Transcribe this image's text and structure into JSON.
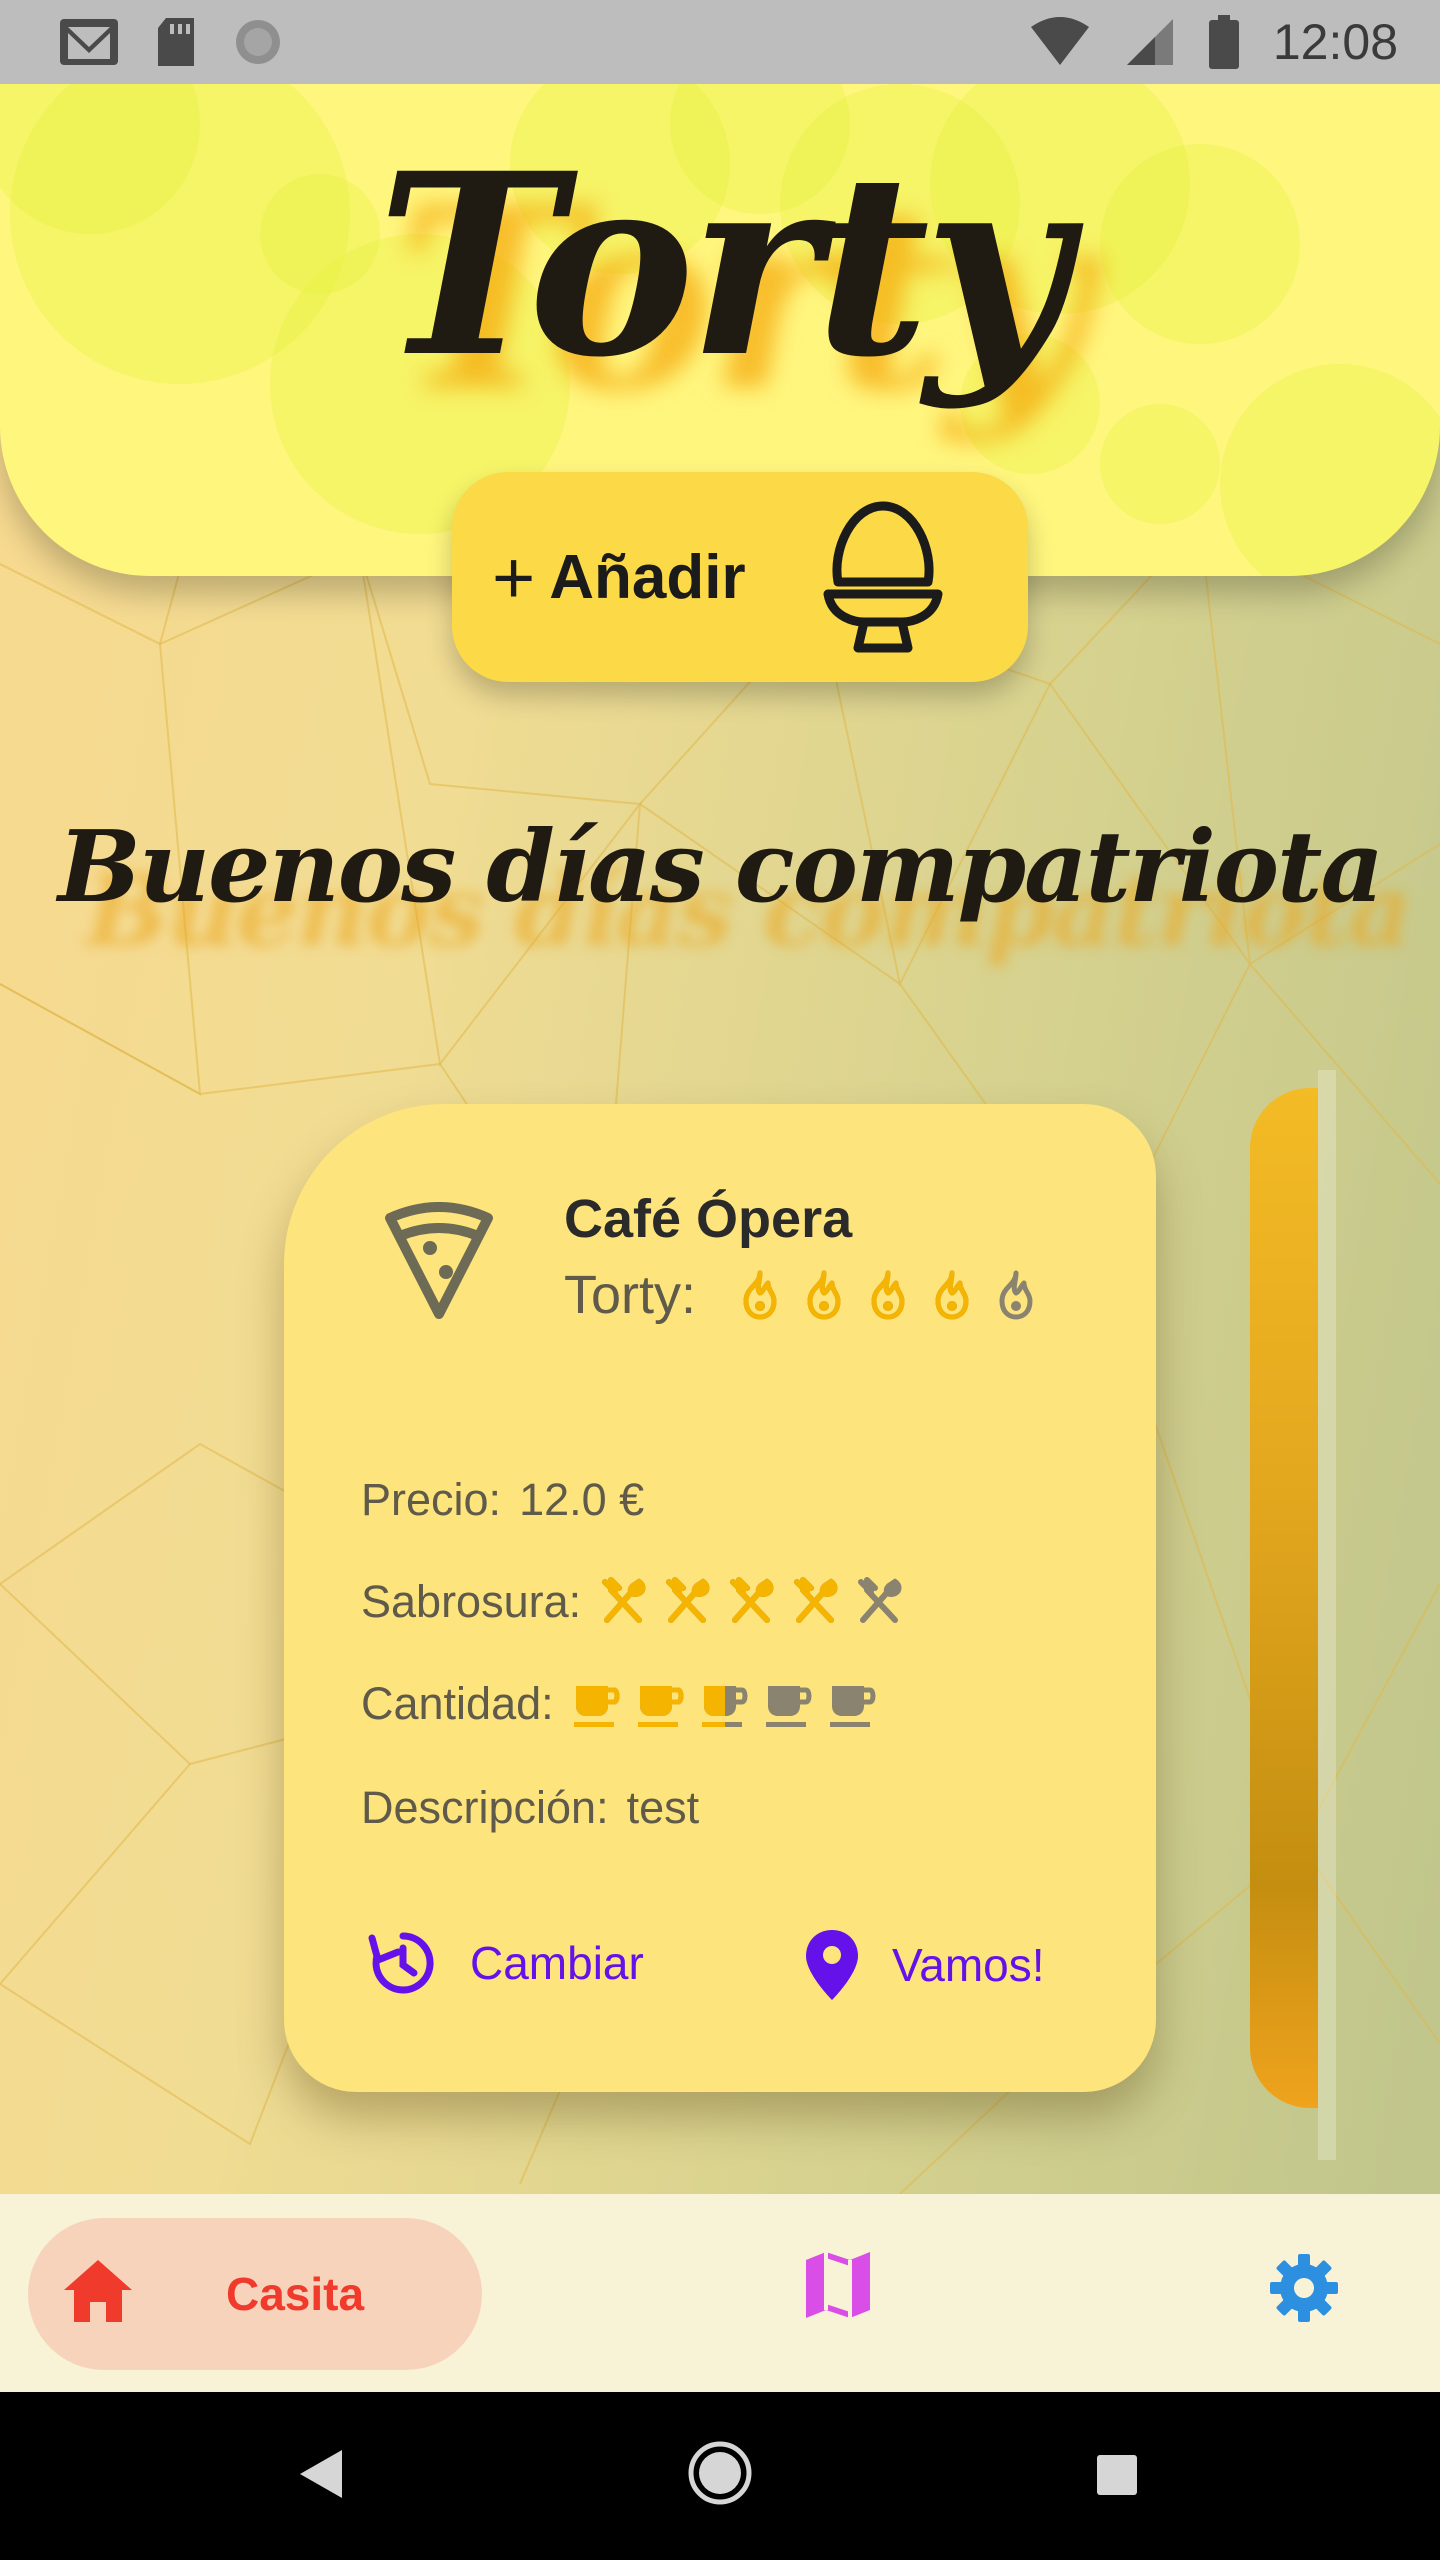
{
  "status_bar": {
    "time": "12:08",
    "icons": [
      "gmail-icon",
      "sd-card-icon",
      "sync-icon",
      "wifi-icon",
      "signal-icon",
      "battery-icon"
    ]
  },
  "header": {
    "app_title": "Torty",
    "add_button_plus": "+",
    "add_button_label": "Añadir",
    "add_button_icon": "egg-icon"
  },
  "greeting": "Buenos días compatriota",
  "card": {
    "icon": "pizza-slice-icon",
    "place_name": "Café Ópera",
    "torty_label": "Torty:",
    "torty_rating": {
      "value": 4,
      "max": 5,
      "icon": "flame-icon"
    },
    "price_label": "Precio:",
    "price_value": "12.0 €",
    "taste_label": "Sabrosura:",
    "taste_rating": {
      "value": 4,
      "max": 5,
      "icon": "cutlery-icon"
    },
    "quantity_label": "Cantidad:",
    "quantity_rating": {
      "value": 2.5,
      "max": 5,
      "icon": "cup-icon"
    },
    "description_label": "Descripción:",
    "description_value": "test",
    "change_label": "Cambiar",
    "go_label": "Vamos!"
  },
  "bottom_nav": {
    "home_label": "Casita",
    "items": [
      "home-icon",
      "map-icon",
      "settings-icon"
    ]
  },
  "colors": {
    "header_bg": "#fff67e",
    "add_button_bg": "#fcd946",
    "card_bg": "#fde47c",
    "rating_active": "#f4b400",
    "rating_inactive": "#8a8370",
    "action_color": "#6411ea",
    "home_active": "#ef3a2c",
    "home_pill": "#f8d3bb",
    "map_color": "#d84ee6",
    "settings_color": "#2d8fe0"
  }
}
